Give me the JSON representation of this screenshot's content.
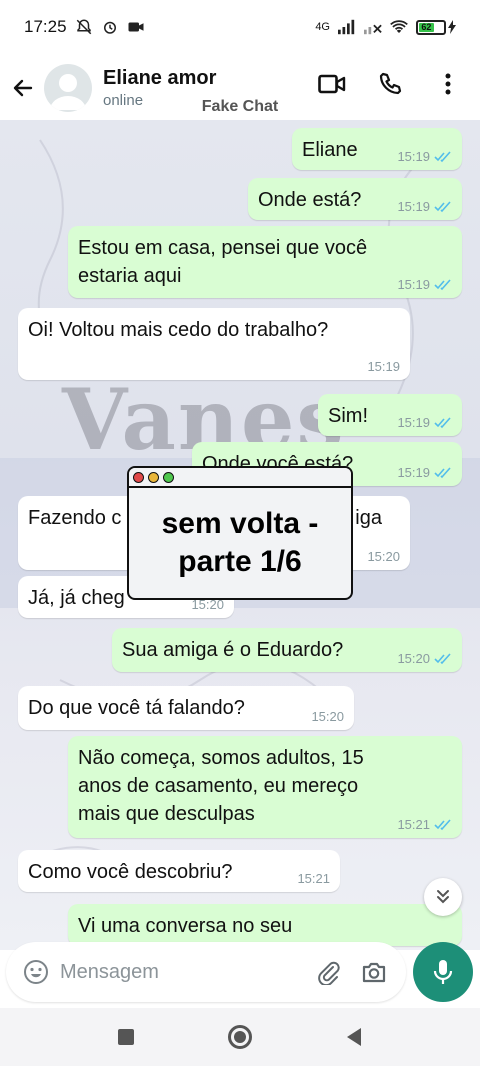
{
  "status": {
    "time": "17:25",
    "network": "4G",
    "battery": "62"
  },
  "header": {
    "contact_name": "Eliane amor",
    "contact_status": "online",
    "watermark": "Fake Chat"
  },
  "background": {
    "brand_word": "Vanes"
  },
  "messages": [
    {
      "dir": "out",
      "text": "Eliane",
      "time": "15:19"
    },
    {
      "dir": "out",
      "text": "Onde está?",
      "time": "15:19"
    },
    {
      "dir": "out",
      "text": "Estou em casa, pensei que você estaria aqui",
      "time": "15:19"
    },
    {
      "dir": "in",
      "text": "Oi! Voltou mais cedo do trabalho?",
      "time": "15:19"
    },
    {
      "dir": "out",
      "text": "Sim!",
      "time": "15:19"
    },
    {
      "dir": "out",
      "text": "Onde você está?",
      "time": "15:19"
    },
    {
      "dir": "in",
      "text": "Fazendo c",
      "text_tail": "iga",
      "time": "15:20"
    },
    {
      "dir": "in",
      "text": "Já, já cheg",
      "time": "15:20"
    },
    {
      "dir": "out",
      "text": "Sua amiga é o Eduardo?",
      "time": "15:20"
    },
    {
      "dir": "in",
      "text": "Do que você tá falando?",
      "time": "15:20"
    },
    {
      "dir": "out",
      "text": "Não começa, somos adultos, 15 anos de casamento, eu mereço mais que desculpas",
      "time": "15:21"
    },
    {
      "dir": "in",
      "text": "Como você descobriu?",
      "time": "15:21"
    },
    {
      "dir": "out",
      "text": "Vi uma conversa no seu telefone.",
      "time": ""
    }
  ],
  "overlay": {
    "title": "sem volta - parte 1/6"
  },
  "composer": {
    "placeholder": "Mensagem"
  },
  "colors": {
    "outgoing_bubble": "#d9fdd3",
    "incoming_bubble": "#ffffff",
    "accent": "#1d8f78",
    "read_ticks": "#53bdeb"
  }
}
